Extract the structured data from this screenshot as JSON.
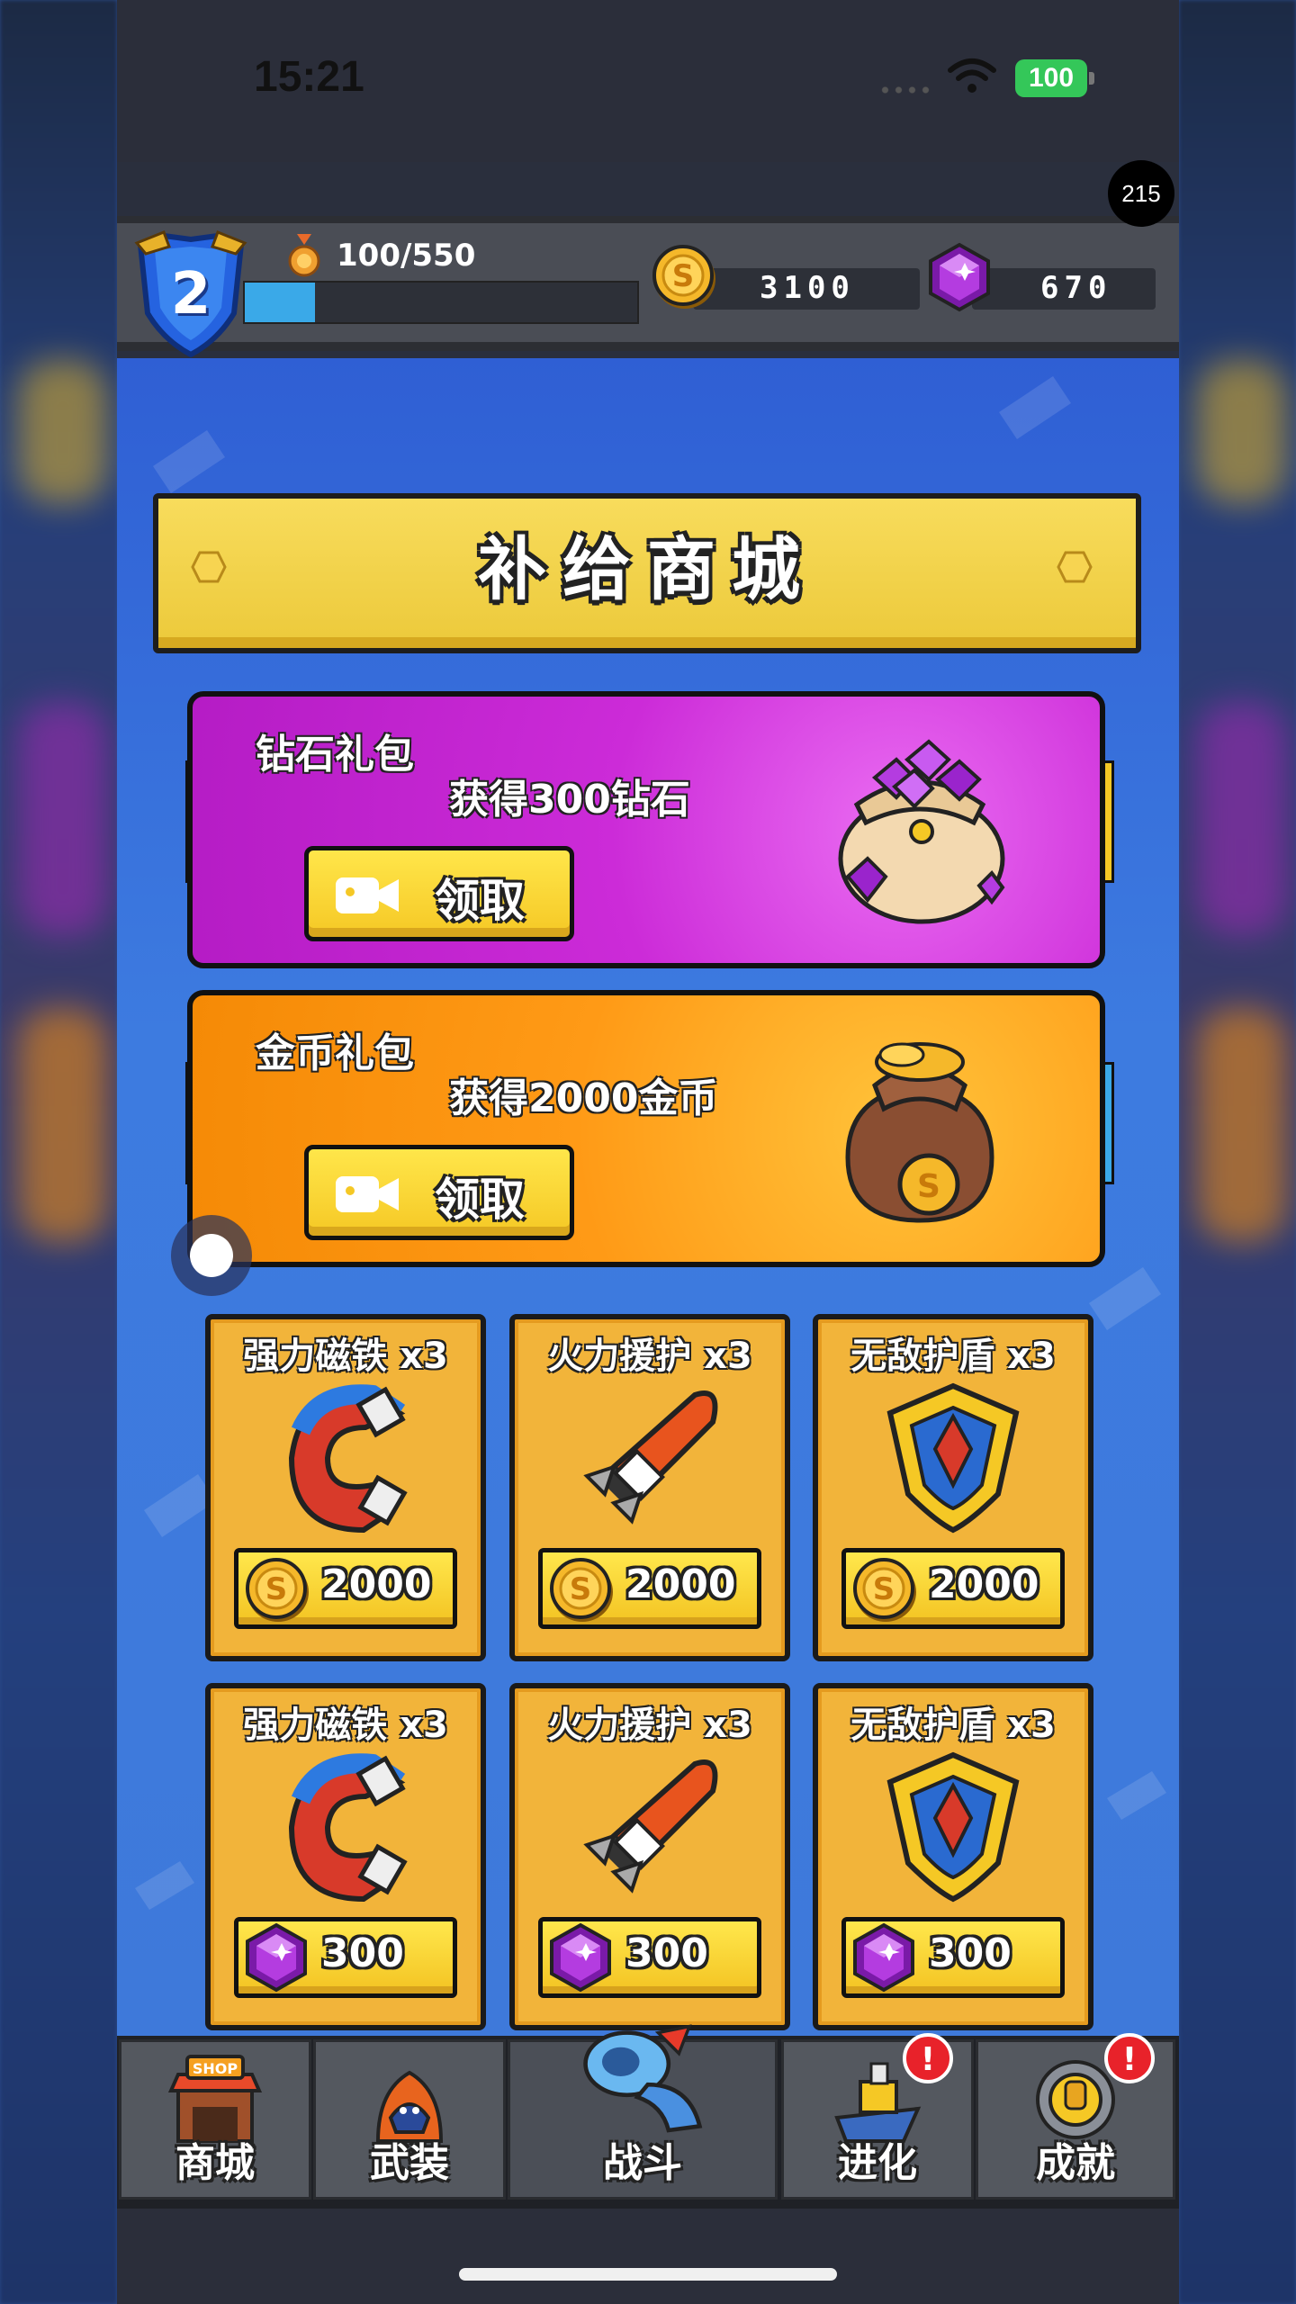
{
  "status_bar": {
    "time": "15:21",
    "battery": "100"
  },
  "overlay_badge": "215",
  "player": {
    "level": "2",
    "xp": "100/550",
    "xp_progress": 0.18
  },
  "currency": {
    "coins": "3100",
    "gems": "670"
  },
  "shop": {
    "title": "补给商城"
  },
  "packs": [
    {
      "name": "钻石礼包",
      "desc": "获得300钻石",
      "button": "领取"
    },
    {
      "name": "金币礼包",
      "desc": "获得2000金币",
      "button": "领取"
    }
  ],
  "items": [
    {
      "name": "强力磁铁 x3",
      "price": "2000",
      "currency": "coin-icon",
      "icon": "magnet-icon"
    },
    {
      "name": "火力援护 x3",
      "price": "2000",
      "currency": "coin-icon",
      "icon": "rocket-icon"
    },
    {
      "name": "无敌护盾 x3",
      "price": "2000",
      "currency": "coin-icon",
      "icon": "shield-icon"
    },
    {
      "name": "强力磁铁 x3",
      "price": "300",
      "currency": "gem-icon",
      "icon": "magnet-icon"
    },
    {
      "name": "火力援护 x3",
      "price": "300",
      "currency": "gem-icon",
      "icon": "rocket-icon"
    },
    {
      "name": "无敌护盾 x3",
      "price": "300",
      "currency": "gem-icon",
      "icon": "shield-icon"
    }
  ],
  "tabs": [
    {
      "label": "商城",
      "icon": "shop-icon",
      "alert": ""
    },
    {
      "label": "武装",
      "icon": "hero-icon",
      "alert": ""
    },
    {
      "label": "战斗",
      "icon": "cannon-icon",
      "alert": ""
    },
    {
      "label": "进化",
      "icon": "ship-icon",
      "alert": "!"
    },
    {
      "label": "成就",
      "icon": "trophy-icon",
      "alert": "!"
    }
  ],
  "colors": {
    "accent_yellow": "#f5c825",
    "diamond_pack": "#cc2bd8",
    "gold_pack": "#ff9a16",
    "card": "#f2b43a"
  }
}
